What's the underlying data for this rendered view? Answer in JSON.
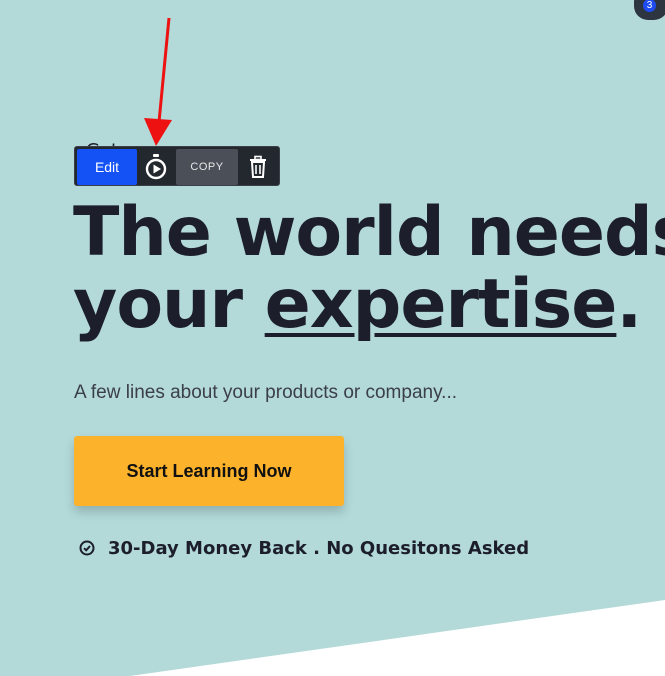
{
  "badge": {
    "count": "3"
  },
  "toolbar": {
    "edit_label": "Edit",
    "copy_label": "COPY",
    "timer_icon": "stopwatch-play-icon",
    "trash_icon": "trash-icon"
  },
  "hero": {
    "hidden_label": "Get...",
    "headline_line1": "The world needs",
    "headline_line2_start": "your ",
    "headline_line2_underlined": "expertise",
    "headline_line2_end": ".",
    "subtitle": "A few lines about your products or company...",
    "cta_label": "Start Learning Now",
    "guarantee_text": "30-Day Money Back . No Quesitons Asked",
    "guarantee_icon": "check-circle-icon"
  },
  "colors": {
    "background": "#b3d9d9",
    "cta": "#fdb22b",
    "edit_button": "#1552f5",
    "annotation_arrow": "#ee1111"
  }
}
